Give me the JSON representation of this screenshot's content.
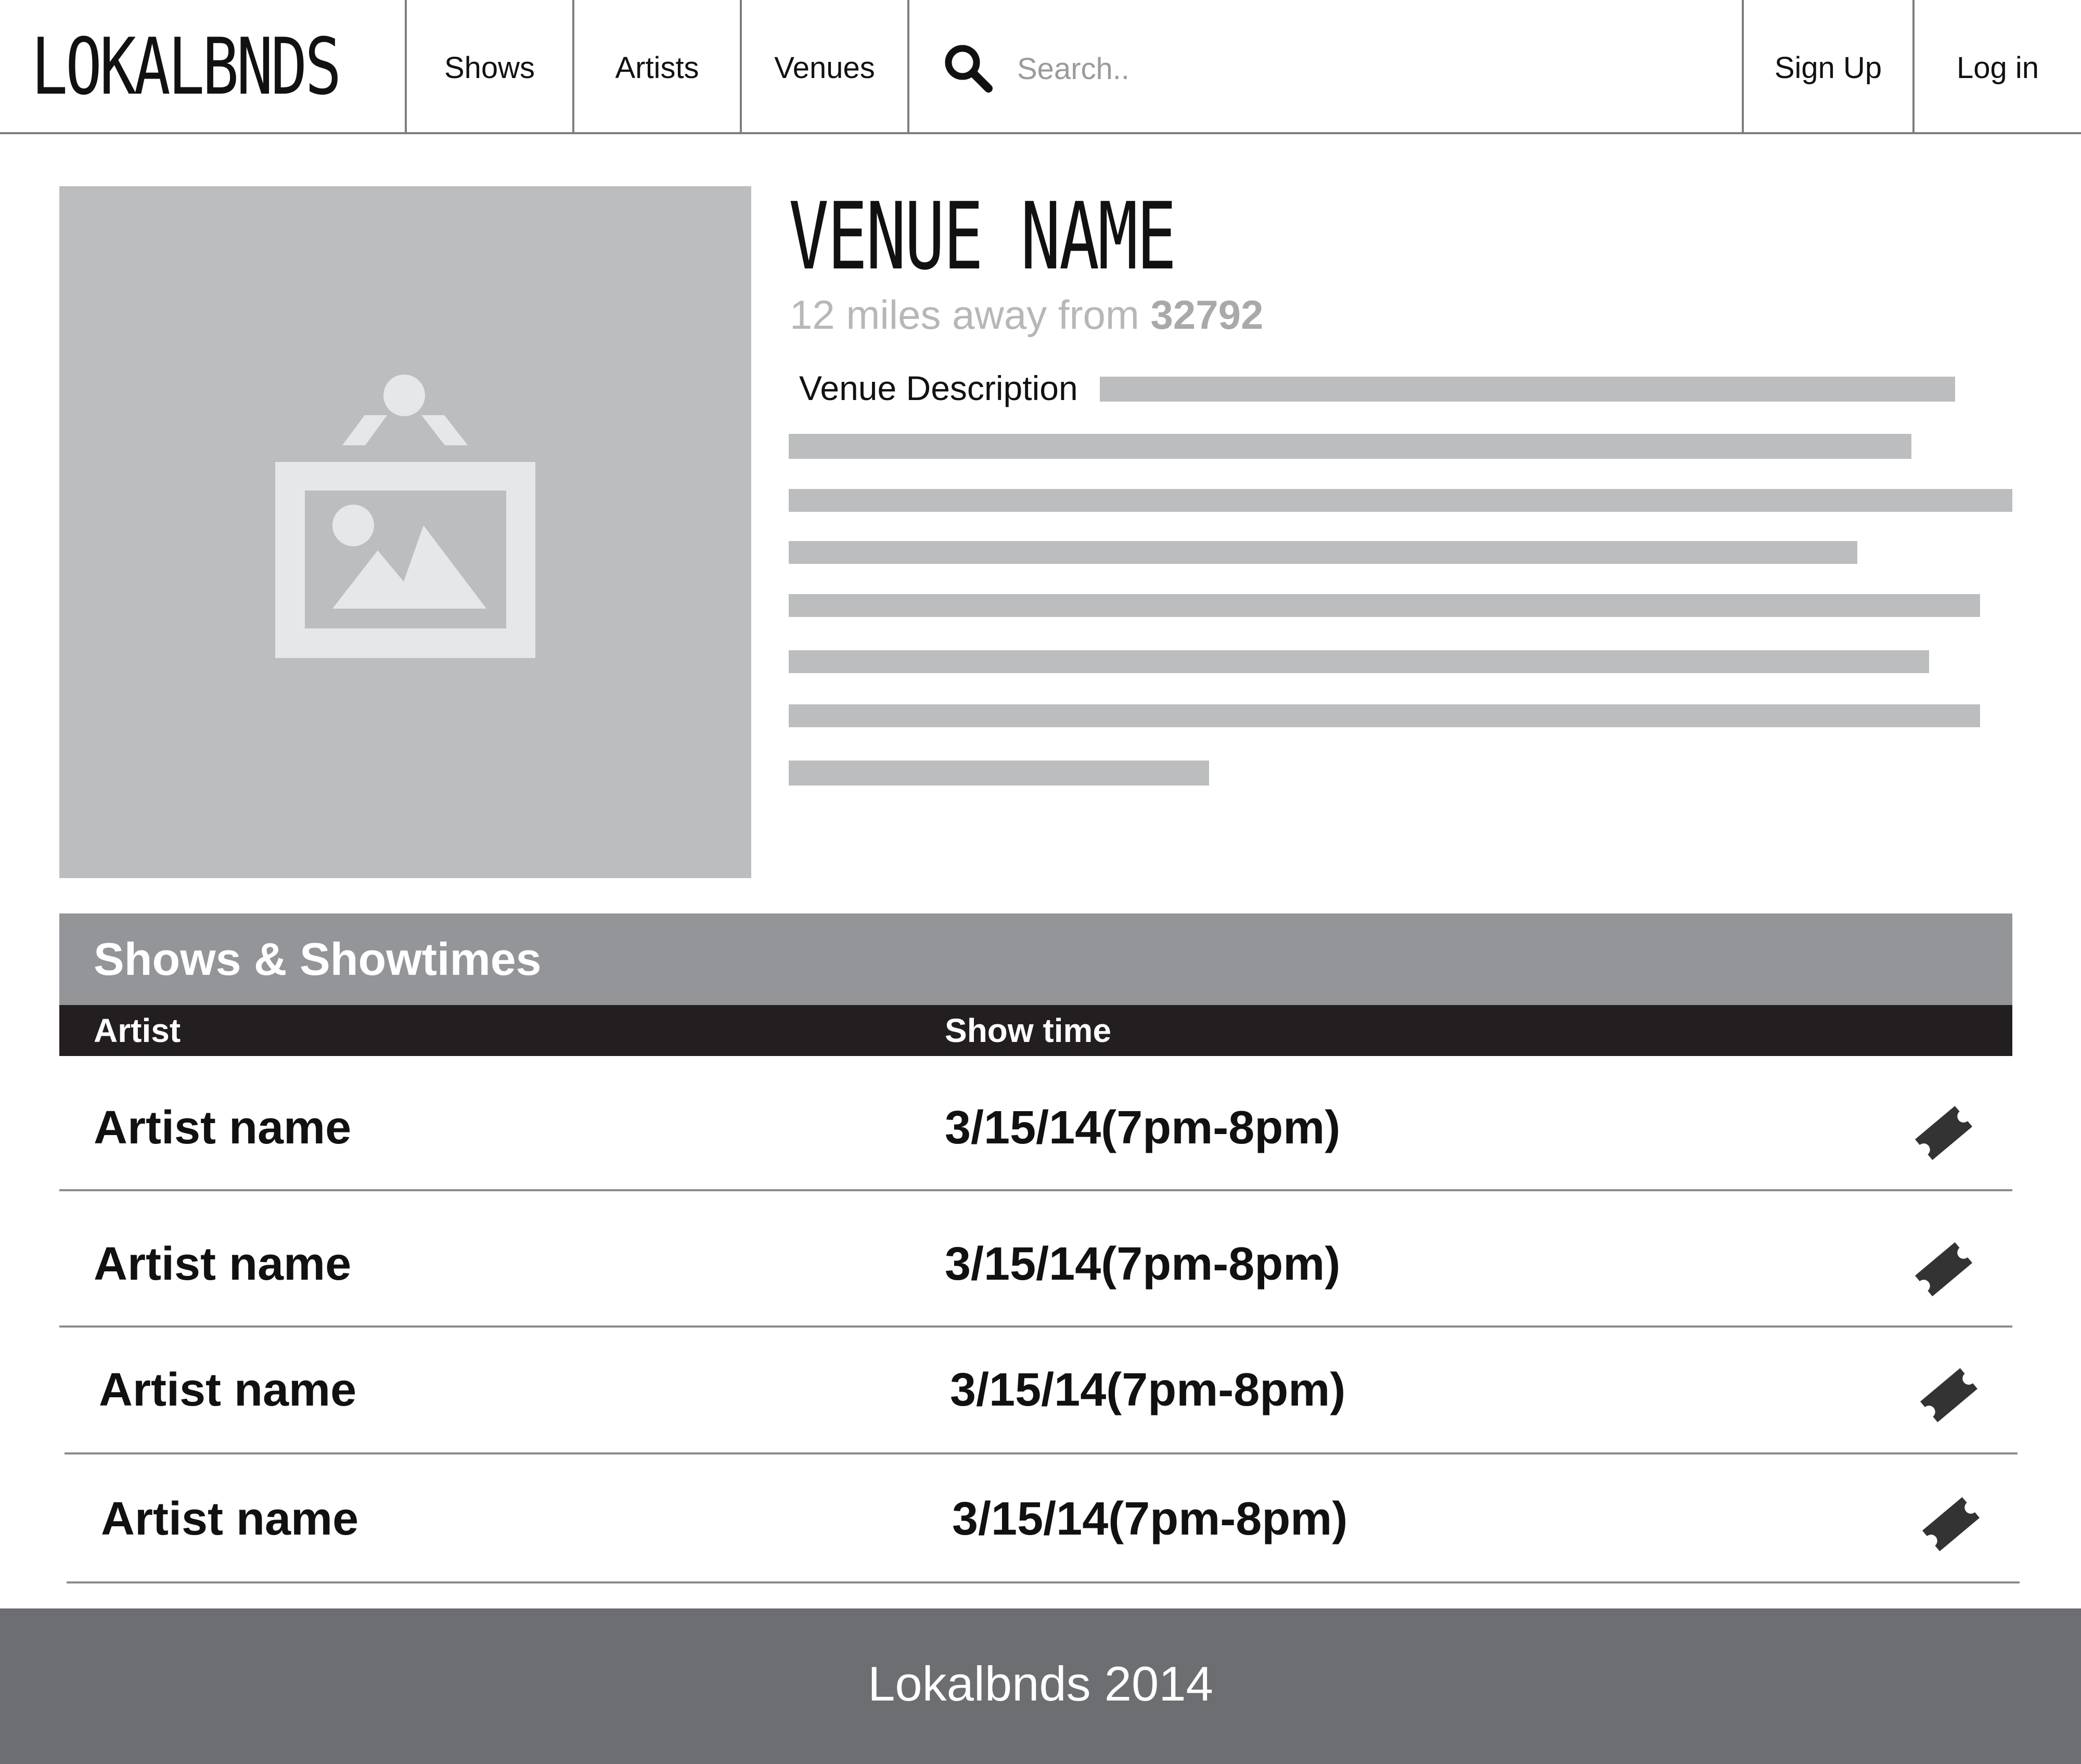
{
  "brand": {
    "logo_text": "LOKALBNDS"
  },
  "nav": {
    "items": [
      {
        "label": "Shows"
      },
      {
        "label": "Artists"
      },
      {
        "label": "Venues"
      }
    ],
    "search": {
      "placeholder": "Search..",
      "value": "",
      "icon": "search-icon"
    },
    "account": {
      "signup_label": "Sign Up",
      "login_label": "Log in"
    }
  },
  "venue": {
    "name": "VENUE NAME",
    "distance_text": "12 miles away from ",
    "zip": "32792",
    "description_label": "Venue Description",
    "image_icon": "image-placeholder-icon"
  },
  "shows": {
    "title": "Shows & Showtimes",
    "columns": {
      "artist": "Artist",
      "showtime": "Show time"
    },
    "rows": [
      {
        "artist": "Artist name",
        "time": "3/15/14(7pm-8pm)",
        "icon": "ticket-icon"
      },
      {
        "artist": "Artist name",
        "time": "3/15/14(7pm-8pm)",
        "icon": "ticket-icon"
      },
      {
        "artist": "Artist name",
        "time": "3/15/14(7pm-8pm)",
        "icon": "ticket-icon"
      },
      {
        "artist": "Artist name",
        "time": "3/15/14(7pm-8pm)",
        "icon": "ticket-icon"
      }
    ]
  },
  "footer": {
    "text": "Lokalbnds 2014"
  },
  "colors": {
    "placeholder_gray": "#bcbdbf",
    "section_header": "#939598",
    "column_header": "#231f20",
    "footer": "#6d6e71",
    "divider": "#7d7e80"
  }
}
